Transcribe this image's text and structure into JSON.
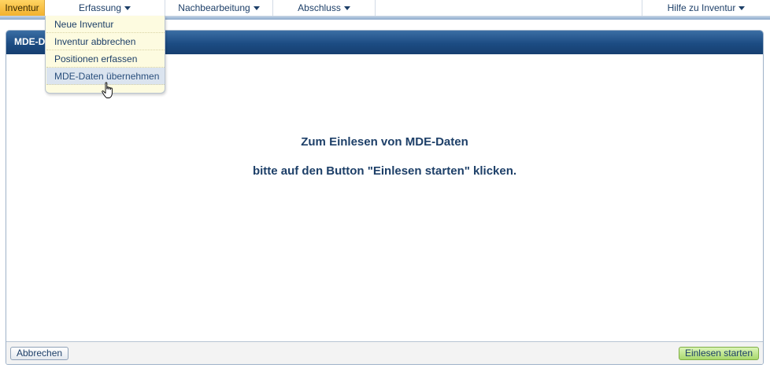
{
  "menubar": {
    "items": [
      {
        "label": "Inventur",
        "active": true
      },
      {
        "label": "Erfassung"
      },
      {
        "label": "Nachbearbeitung"
      },
      {
        "label": "Abschluss"
      }
    ],
    "help_label": "Hilfe zu Inventur"
  },
  "dropdown": {
    "items": [
      {
        "label": "Neue Inventur"
      },
      {
        "label": "Inventur abbrechen"
      },
      {
        "label": "Positionen erfassen"
      },
      {
        "label": "MDE-Daten übernehmen",
        "hovered": true
      }
    ]
  },
  "panel": {
    "title": "MDE-Da",
    "message_line1": "Zum Einlesen von MDE-Daten",
    "message_line2": "bitte auf den Button \"Einlesen starten\" klicken."
  },
  "footer": {
    "cancel_label": "Abbrechen",
    "start_label": "Einlesen starten"
  },
  "colors": {
    "active_menu": "#f2b12e",
    "header_blue": "#1c4c83",
    "dropdown_bg": "#fdfbe0",
    "start_button": "#a8d86c",
    "text": "#1d3f68"
  },
  "icons": {
    "menu_caret": "chevron-down-icon",
    "cursor": "hand-pointer-icon"
  }
}
